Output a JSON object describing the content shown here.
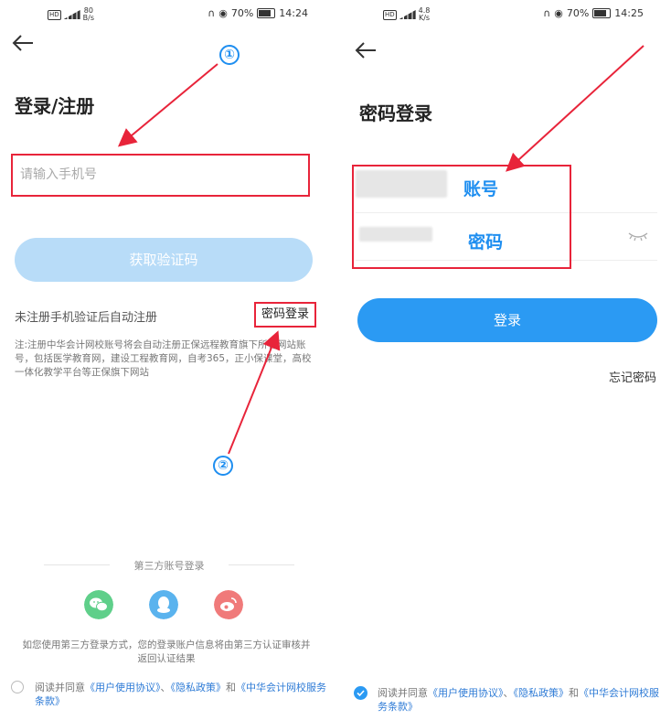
{
  "left": {
    "status": {
      "net": "80\nB/s",
      "battery": "70%",
      "time": "14:24"
    },
    "title": "登录/注册",
    "phone_placeholder": "请输入手机号",
    "get_code_button": "获取验证码",
    "auto_register_hint": "未注册手机验证后自动注册",
    "password_login_link": "密码登录",
    "note": "注:注册中华会计网校账号将会自动注册正保远程教育旗下所有网站账号，包括医学教育网，建设工程教育网，自考365，正小保课堂，高校一体化教学平台等正保旗下网站",
    "third_party_label": "第三方账号登录",
    "third_party_disclaimer": "如您使用第三方登录方式，您的登录账户信息将由第三方认证审核并返回认证结果",
    "agreement": {
      "prefix": "阅读并同意",
      "user_agreement": "《用户使用协议》",
      "sep": "、",
      "privacy": "《隐私政策》",
      "and": "和",
      "service_terms": "《中华会计网校服务条款》"
    }
  },
  "right": {
    "status": {
      "net": "4.8\nK/s",
      "battery": "70%",
      "time": "14:25"
    },
    "title": "密码登录",
    "account_label": "账号",
    "password_label": "密码",
    "login_button": "登录",
    "forgot_password": "忘记密码",
    "agreement": {
      "prefix": "阅读并同意",
      "user_agreement": "《用户使用协议》",
      "sep": "、",
      "privacy": "《隐私政策》",
      "and": "和",
      "service_terms": "《中华会计网校服务条款》"
    }
  },
  "annotations": {
    "step1": "①",
    "step2": "②"
  },
  "colors": {
    "accent": "#2b9af3",
    "disabled": "#b8dcf8",
    "annotation_red": "#e8243a",
    "link": "#2e7bd6"
  },
  "icons": [
    "back-arrow-icon",
    "wechat-icon",
    "qq-icon",
    "weibo-icon",
    "eye-closed-icon"
  ]
}
